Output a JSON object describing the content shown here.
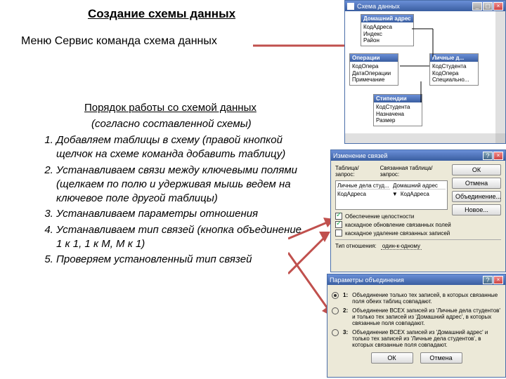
{
  "title": "Создание схемы данных",
  "menu_path": "Меню Сервис команда схема данных",
  "procedure": {
    "heading": "Порядок работы со схемой данных",
    "sub": "(согласно составленной схемы)",
    "steps": [
      "Добавляем таблицы в схему (правой кнопкой щелчок на схеме команда добавить таблицу)",
      "Устанавливаем связи между ключевыми полями (щелкаем по полю и удерживая мышь ведем на ключевое поле другой таблицы)",
      "Устанавливаем параметры отношения",
      "Устанавливаем тип связей (кнопка объединение 1 к 1, 1 к М, М к 1)",
      "Проверяем установленный тип связей"
    ]
  },
  "schema_window": {
    "title": "Схема данных",
    "tables": {
      "home": {
        "name": "Домашний адрес",
        "fields": [
          "КодАдреса",
          "Индекс",
          "Район"
        ]
      },
      "oper": {
        "name": "Операции",
        "fields": [
          "КодОпера",
          "ДатаОперации",
          "Примечание"
        ]
      },
      "personal": {
        "name": "Личные д...",
        "fields": [
          "КодСтудента",
          "КодОпера",
          "Специально..."
        ]
      },
      "stip": {
        "name": "Стипендии",
        "fields": [
          "КодСтудента",
          "Назначена",
          "Размер"
        ]
      }
    }
  },
  "edit_links": {
    "title": "Изменение связей",
    "col1": "Таблица/запрос:",
    "col2": "Связанная таблица/запрос:",
    "row1a": "Личные дела студ...",
    "row1b": "Домашний адрес",
    "row2a": "КодАдреса",
    "row2b": "КодАдреса",
    "chk1": "Обеспечение целостности",
    "chk2": "каскадное обновление связанных полей",
    "chk3": "каскадное удаление связанных записей",
    "rel_label": "Тип отношения:",
    "rel_value": "один-к-одному",
    "btn_ok": "ОК",
    "btn_cancel": "Отмена",
    "btn_join": "Объединение...",
    "btn_new": "Новое..."
  },
  "join_params": {
    "title": "Параметры объединения",
    "opt1": "Объединение только тех записей, в которых связанные поля обеих таблиц совпадают.",
    "opt2": "Объединение ВСЕХ записей из 'Личные дела студентов' и только тех записей из 'Домашний адрес', в которых связанные поля совпадают.",
    "opt3": "Объединение ВСЕХ записей из 'Домашний адрес' и только тех записей из 'Личные дела студентов', в которых связанные поля совпадают.",
    "btn_ok": "ОК",
    "btn_cancel": "Отмена"
  }
}
